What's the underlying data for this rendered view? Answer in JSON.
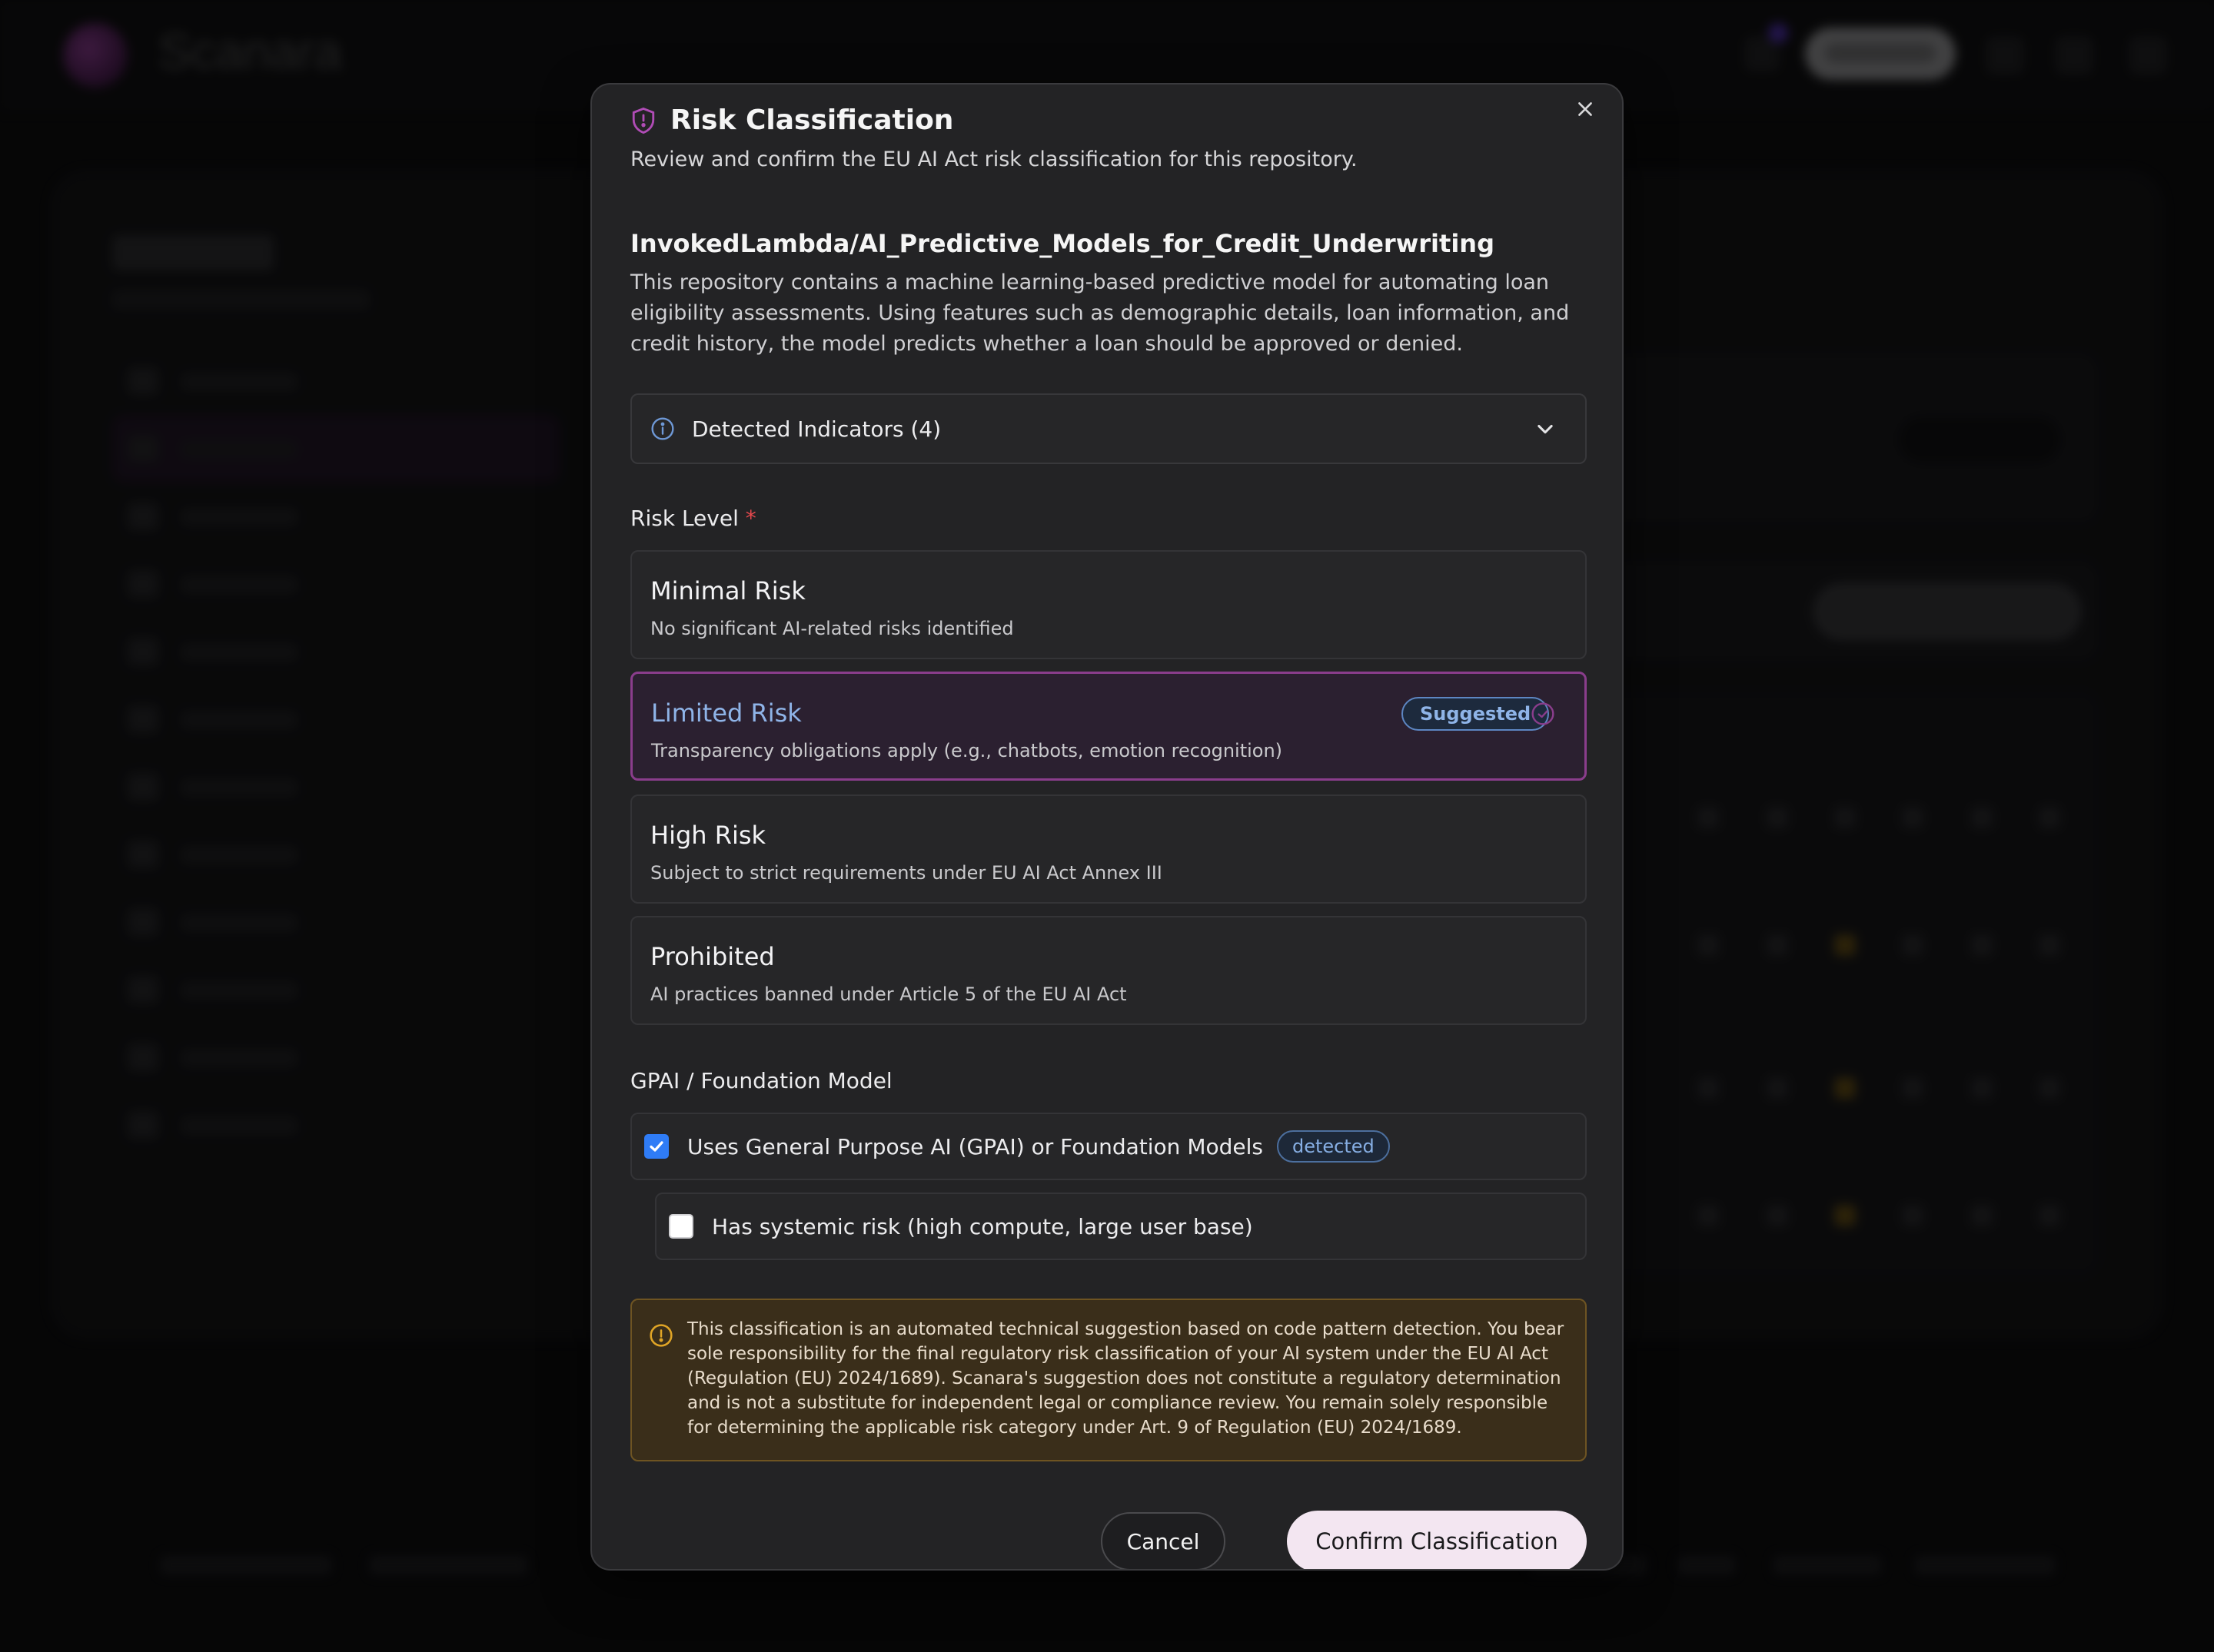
{
  "background_app": {
    "brand": "Scanara"
  },
  "modal": {
    "title": "Risk Classification",
    "subtitle": "Review and confirm the EU AI Act risk classification for this repository.",
    "repository": {
      "name": "InvokedLambda/AI_Predictive_Models_for_Credit_Underwriting",
      "description": "This repository contains a machine learning-based predictive model for automating loan eligibility assessments. Using features such as demographic details, loan information, and credit history, the model predicts whether a loan should be approved or denied."
    },
    "indicators": {
      "label": "Detected Indicators (4)"
    },
    "risk_level": {
      "label": "Risk Level",
      "required_mark": "*",
      "options": [
        {
          "name": "Minimal Risk",
          "description": "No significant AI-related risks identified"
        },
        {
          "name": "Limited Risk",
          "description": "Transparency obligations apply (e.g., chatbots, emotion recognition)",
          "badge": "Suggested",
          "selected": true
        },
        {
          "name": "High Risk",
          "description": "Subject to strict requirements under EU AI Act Annex III"
        },
        {
          "name": "Prohibited",
          "description": "AI practices banned under Article 5 of the EU AI Act"
        }
      ]
    },
    "gpai": {
      "label": "GPAI / Foundation Model",
      "uses_gpai": {
        "label": "Uses General Purpose AI (GPAI) or Foundation Models",
        "badge": "detected",
        "checked": true
      },
      "systemic_risk": {
        "label": "Has systemic risk (high compute, large user base)",
        "checked": false
      }
    },
    "disclaimer": "This classification is an automated technical suggestion based on code pattern detection. You bear sole responsibility for the final regulatory risk classification of your AI system under the EU AI Act (Regulation (EU) 2024/1689). Scanara's suggestion does not constitute a regulatory determination and is not a substitute for independent legal or compliance review. You remain solely responsible for determining the applicable risk category under Art. 9 of Regulation (EU) 2024/1689.",
    "buttons": {
      "cancel": "Cancel",
      "confirm": "Confirm Classification"
    }
  },
  "colors": {
    "accent_selected": "#8a3d8c",
    "suggested_blue": "#8fb4e8",
    "checkbox_blue": "#2f7cf6",
    "warning_bg": "#3a2e1a",
    "required_red": "#e5484d"
  }
}
